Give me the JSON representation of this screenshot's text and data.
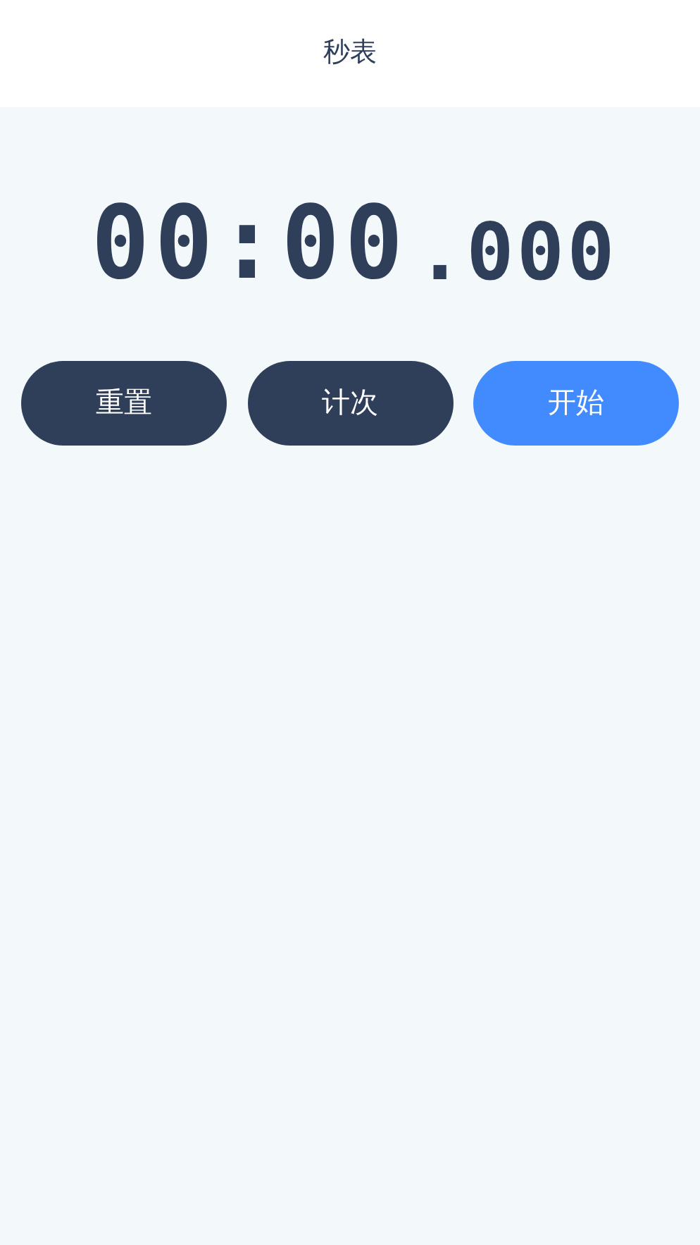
{
  "header": {
    "title": "秒表"
  },
  "timer": {
    "minutes_seconds": "00:00",
    "milliseconds": ".000"
  },
  "buttons": [
    {
      "label": "重置",
      "kind": "secondary"
    },
    {
      "label": "计次",
      "kind": "secondary"
    },
    {
      "label": "开始",
      "kind": "primary"
    }
  ]
}
